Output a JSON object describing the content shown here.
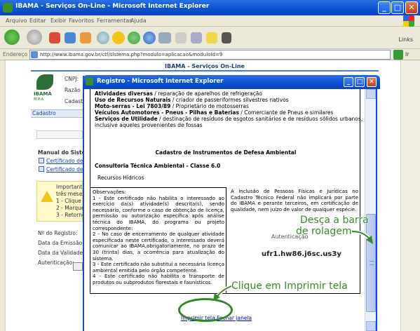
{
  "window": {
    "title": "IBAMA - Serviços On-Line - Microsoft Internet Explorer",
    "minimize": "_",
    "maximize": "□",
    "close": "✕"
  },
  "menu": [
    "Arquivo",
    "Editar",
    "Exibir",
    "Favoritos",
    "Ferramentas",
    "Ajuda"
  ],
  "toolbar": {
    "links_label": "Links"
  },
  "address": {
    "label": "Endereço",
    "url": "http://www.ibama.gov.br/ctf/sistema.php?modulo=aplicacao&moduloId=9",
    "go_label": "Ir"
  },
  "background_page": {
    "header": "IBAMA - Serviços On-Line",
    "logo_text": "IBAMA",
    "logo_sub": "MMA",
    "cnpj_label": "CNPJ:",
    "razao_label": "Razão",
    "cadastro_label": "Cadastro",
    "cadastro_tab": "Cadastro",
    "manual_label": "Manual do Sistem",
    "cert_link_1": "Certificado de",
    "cert_link_2": "Certificado de",
    "warn_lines": [
      "Important",
      "três meses",
      "1 - Clique",
      "2 - Marque",
      "3 - Retorne"
    ],
    "registro_label": "Nº do Registro:",
    "emissao_label": "Data da Emissão",
    "validade_label": "Data da Validade",
    "autenticacao_label": "Autenticação:"
  },
  "popup": {
    "title": "Registro - Microsoft Internet Explorer",
    "activities": [
      {
        "bold": "Atividades diversas",
        "rest": " / reparação de aparelhos de refrigeração"
      },
      {
        "bold": "Uso de Recursos Naturais",
        "rest": " / criador de passeriformes silvestres nativos"
      },
      {
        "bold": "Moto-serras - Lei 7803/89",
        "rest": " / Proprietário de motosserras"
      },
      {
        "bold": "Veículos Automotores - Pneus - Pilhas e Baterias",
        "rest": " / Comerciante de Pneus e similares"
      },
      {
        "bold": "Serviços de Utilidade",
        "rest": " / destinação de resíduos de esgotos sanitários e de resíduos sólidos urbanos,"
      },
      {
        "bold": "",
        "rest": "inclusive aqueles provenientes de fossas"
      }
    ],
    "cadastro_title": "Cadastro de Instrumentos de Defesa Ambiental",
    "consultoria": "Consultoria Técnica Ambiental - Classe 6.0",
    "recursos": "Recursos Hídricos",
    "observacoes": "Observações:\n1 - Este certificado não habilita o interessado ao exercício da(s) atividade(s) descrita(s), sendo necessário, conforme o caso de obtenção de licença, permissão ou autorização específica após análise técnica do IBAMA, do programa ou projeto correspondente:\n2 - No caso de encerramento de qualquer atividade especificada neste certificado, o interessado deverá comunicar ao IBAMA,obrigatoriamente, no prazo de 30 (trinta) dias, a ocorrência para atualização do sistema.\n3 - Este certificado não substitui a necessária licença ambiental emitida pelo órgão competente.\n4 - Este certificado não habilita o transporte de produtos ou subprodutos florestais e faunísticos.",
    "inclusao": "A inclusão de Pessoas Físicas e Jurídicas no Cadastro Técnico Federal não implicará por parte do IBAMA e perante terceiros, em certificação de qualidade, nem juízo de valor de qualquer espécie.",
    "autenticacao_label": "Autenticação",
    "autenticacao_code": "ufr1.hw86.j6sc.us3y",
    "print_link": "Imprimir tela",
    "close_link": "Fechar janela"
  },
  "annotations": {
    "scroll_hint_1": "Desça a barra",
    "scroll_hint_2": "de rolagem",
    "print_hint": "Clique em Imprimir tela"
  },
  "colors": {
    "xp_blue": "#0a4fd0",
    "annotation_green": "#3a8a2a"
  }
}
